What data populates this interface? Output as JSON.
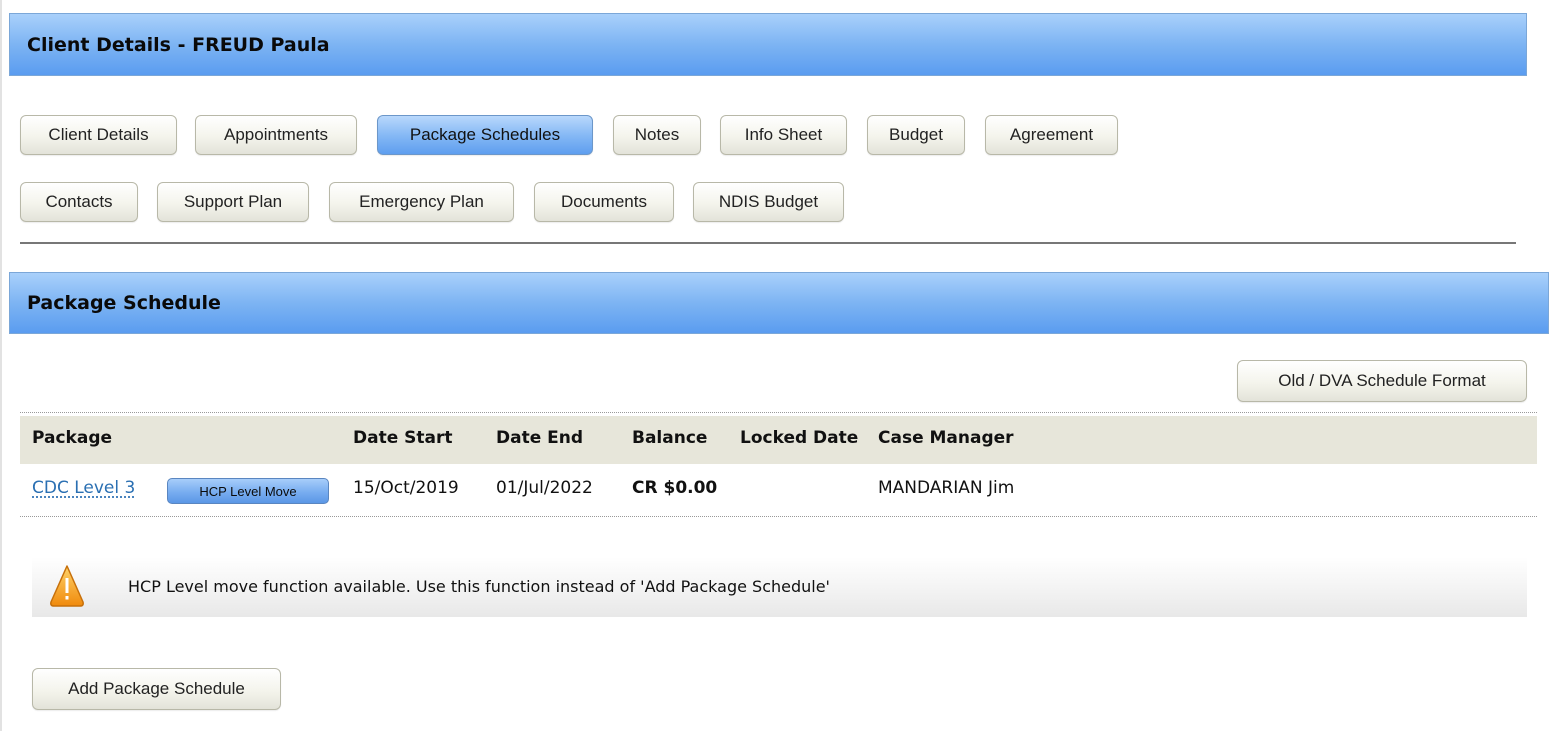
{
  "client_header": {
    "title": "Client Details - FREUD Paula"
  },
  "tabs": [
    {
      "label": "Client Details"
    },
    {
      "label": "Appointments"
    },
    {
      "label": "Package Schedules",
      "active": true
    },
    {
      "label": "Notes"
    },
    {
      "label": "Info Sheet"
    },
    {
      "label": "Budget"
    },
    {
      "label": "Agreement"
    },
    {
      "label": "Contacts"
    },
    {
      "label": "Support Plan"
    },
    {
      "label": "Emergency Plan"
    },
    {
      "label": "Documents"
    },
    {
      "label": "NDIS Budget"
    }
  ],
  "package_header": {
    "title": "Package Schedule"
  },
  "toolbar": {
    "old_format_label": "Old / DVA Schedule Format"
  },
  "table": {
    "columns": [
      "Package",
      "Date Start",
      "Date End",
      "Balance",
      "Locked Date",
      "Case Manager"
    ],
    "rows": [
      {
        "package": "CDC Level 3",
        "badge": "HCP Level Move",
        "date_start": "15/Oct/2019",
        "date_end": "01/Jul/2022",
        "balance": "CR $0.00",
        "locked_date": "",
        "case_manager": "MANDARIAN Jim"
      }
    ]
  },
  "warning": {
    "icon": "warning-triangle-icon",
    "text": "HCP Level move function available. Use this function instead of 'Add Package Schedule'"
  },
  "actions": {
    "add_label": "Add Package Schedule"
  },
  "colors": {
    "header_blue": "#7db4f3",
    "link_blue": "#2a6fb2",
    "grid_header_bg": "#e7e6da",
    "warning_orange": "#f7a21b"
  }
}
